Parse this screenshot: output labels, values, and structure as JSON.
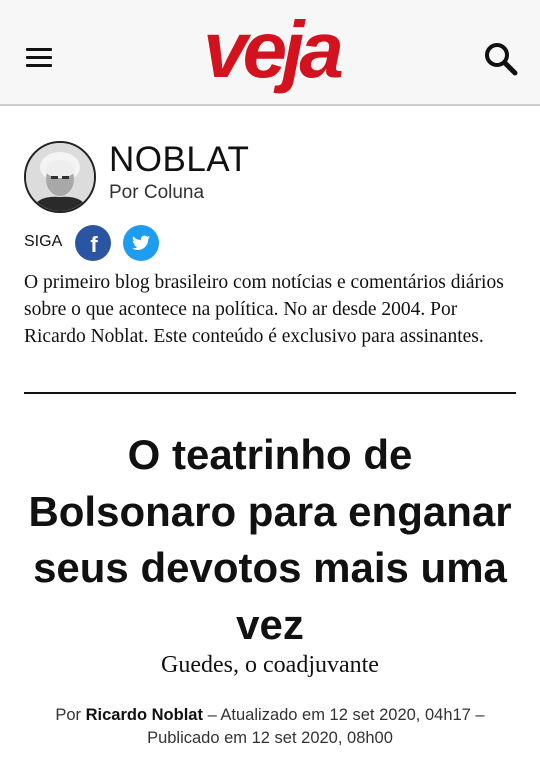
{
  "header": {
    "logo_text": "veja",
    "icons": {
      "menu": "hamburger-menu-icon",
      "search": "search-icon"
    }
  },
  "column": {
    "name": "NOBLAT",
    "subtitle": "Por Coluna",
    "follow_label": "SIGA",
    "facebook_glyph": "f",
    "description": "O primeiro blog brasileiro com notícias e comentários diários sobre o que acontece na política. No ar desde 2004. Por Ricardo Noblat. Este conteúdo é exclusivo para assinantes."
  },
  "article": {
    "title": "O teatrinho de Bolsonaro para enganar seus devotos mais uma vez",
    "subtitle": "Guedes, o coadjuvante",
    "byline_prefix": "Por ",
    "author": "Ricardo Noblat",
    "byline_rest": " – Atualizado em 12 set 2020, 04h17 – Publicado em 12 set 2020, 08h00"
  },
  "colors": {
    "brand_red": "#d3121f",
    "facebook_blue": "#2a55a3",
    "twitter_blue": "#1d9cf0",
    "header_bg": "#f7f7f7"
  }
}
